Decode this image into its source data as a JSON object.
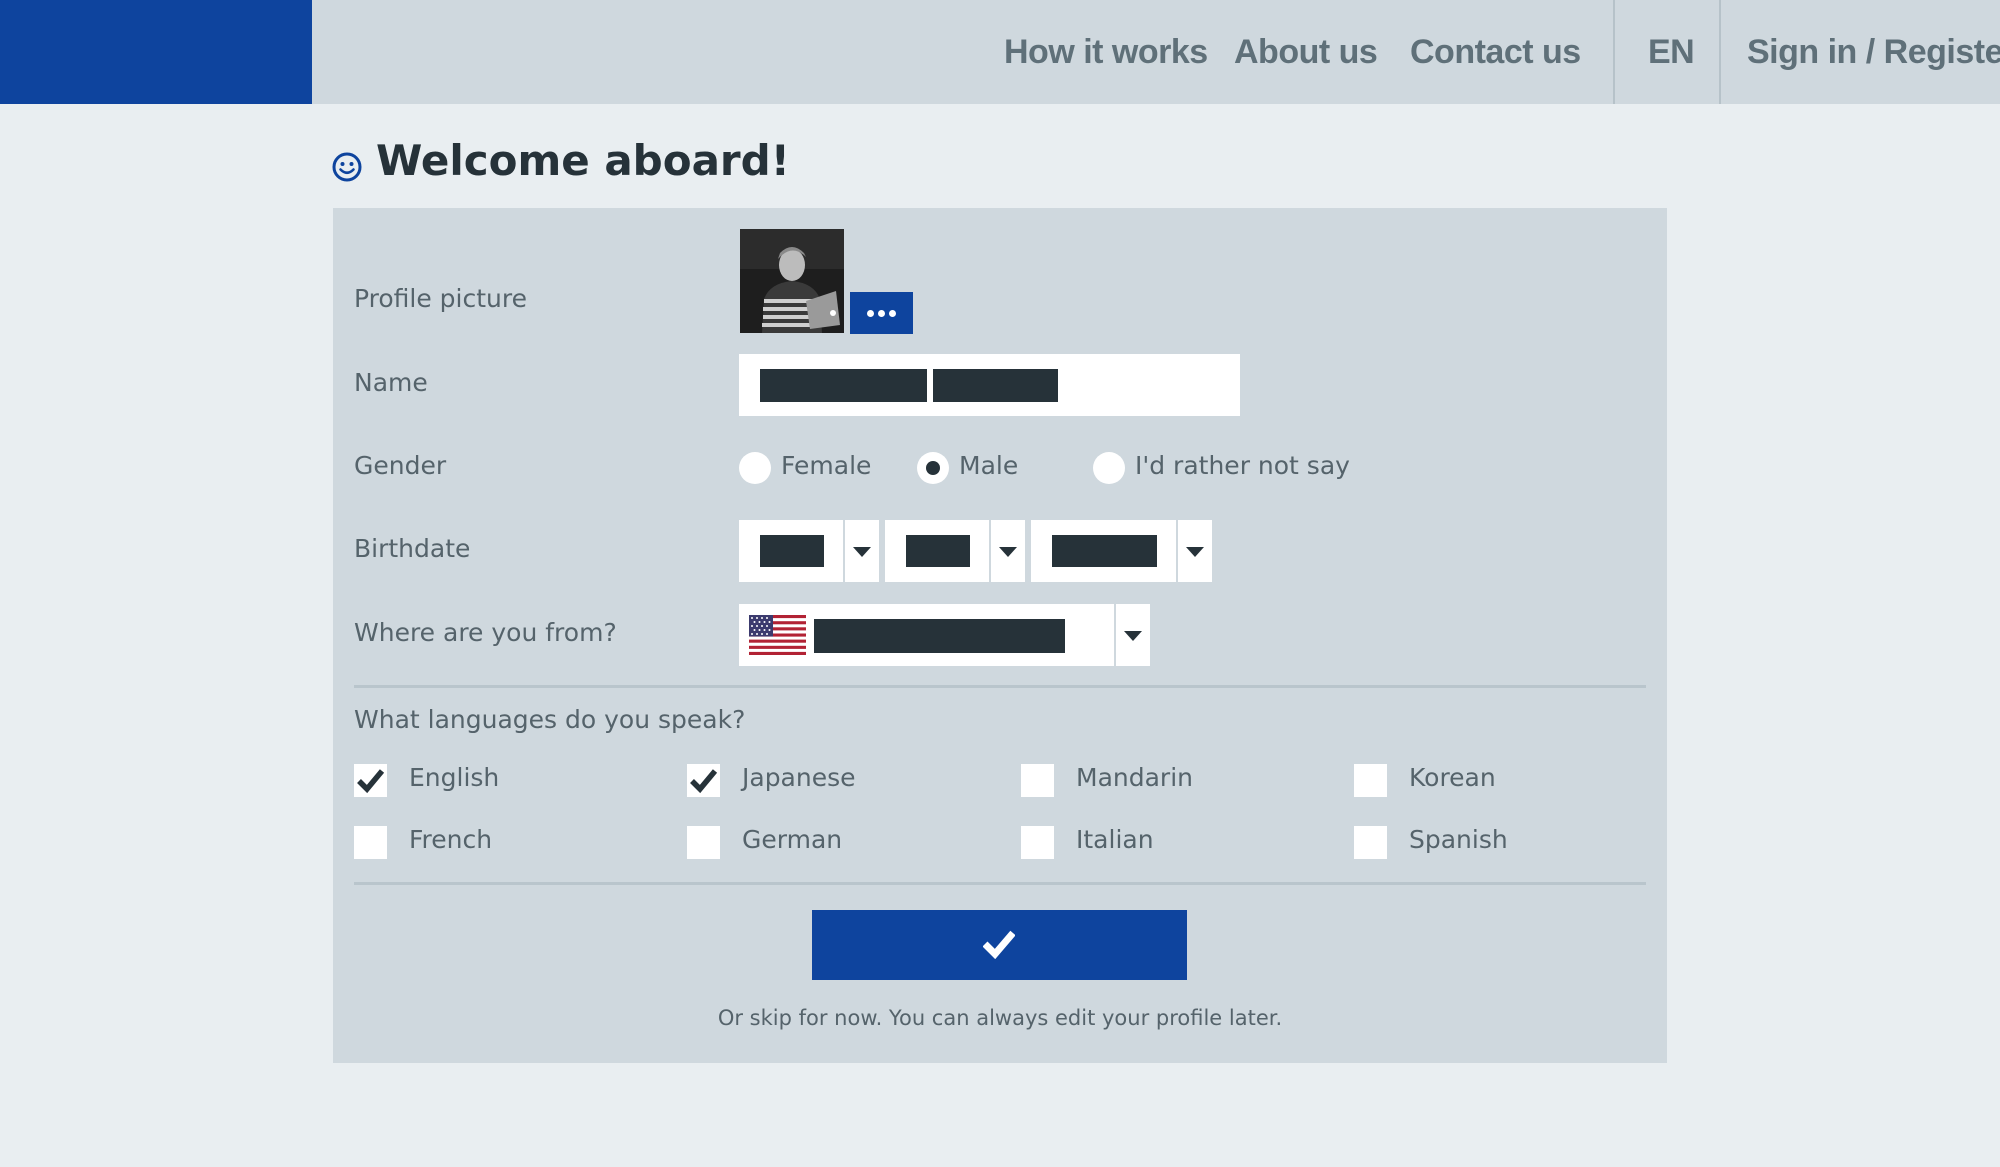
{
  "nav": {
    "links": [
      "How it works",
      "About us",
      "Contact us"
    ],
    "language": "EN",
    "signin": "Sign in / Register"
  },
  "colors": {
    "brand": "#0e449e",
    "panel": "#cfd8de",
    "background": "#e9eef1",
    "text_dark": "#263239",
    "text_muted": "#55636b"
  },
  "page": {
    "title": "Welcome aboard!",
    "title_icon": "smiley-icon"
  },
  "form": {
    "profile_label": "Profile picture",
    "more_button_icon": "more-dots-icon",
    "name_label": "Name",
    "gender_label": "Gender",
    "gender_options": [
      {
        "label": "Female",
        "selected": false
      },
      {
        "label": "Male",
        "selected": true
      },
      {
        "label": "I'd rather not say",
        "selected": false
      }
    ],
    "birthdate_label": "Birthdate",
    "country_label": "Where are you from?",
    "country_flag_icon": "us-flag-icon",
    "languages_label": "What languages do you speak?",
    "languages": [
      {
        "label": "English",
        "checked": true
      },
      {
        "label": "Japanese",
        "checked": true
      },
      {
        "label": "Mandarin",
        "checked": false
      },
      {
        "label": "Korean",
        "checked": false
      },
      {
        "label": "French",
        "checked": false
      },
      {
        "label": "German",
        "checked": false
      },
      {
        "label": "Italian",
        "checked": false
      },
      {
        "label": "Spanish",
        "checked": false
      }
    ],
    "submit_icon": "checkmark-icon",
    "skip_text": "Or skip for now. You can always edit your profile later."
  }
}
